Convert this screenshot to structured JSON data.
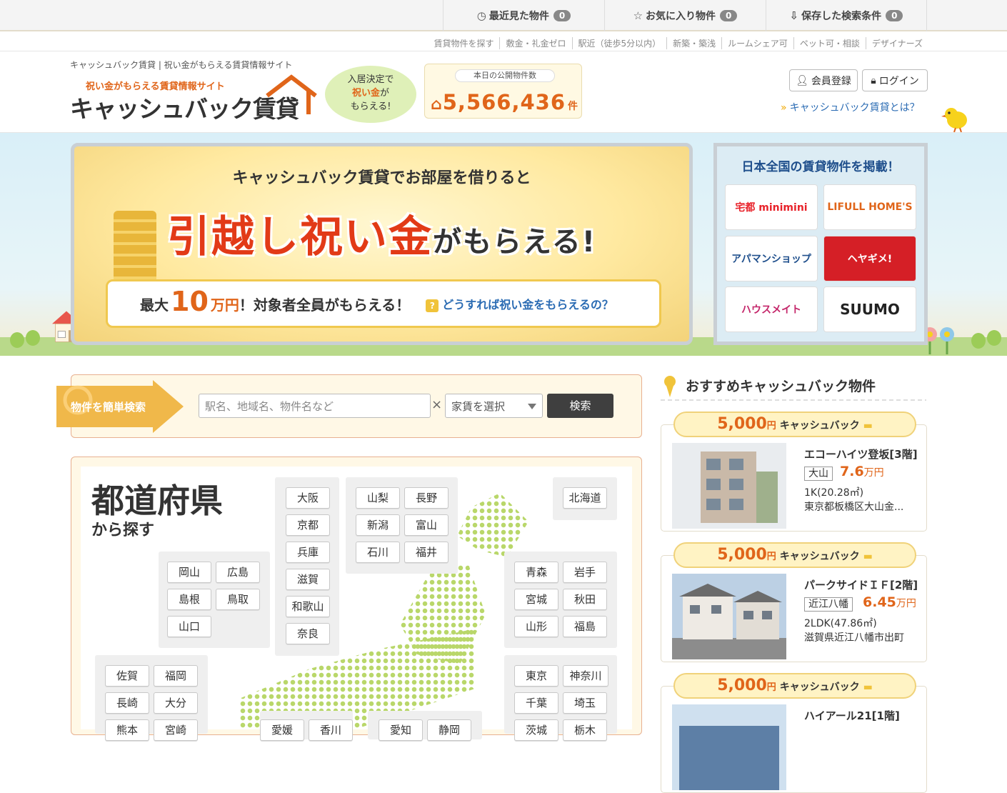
{
  "topbar": {
    "recent": {
      "label": "最近見た物件",
      "count": "0"
    },
    "favorites": {
      "label": "お気に入り物件",
      "count": "0"
    },
    "saved": {
      "label": "保存した検索条件",
      "count": "0"
    }
  },
  "sublinks": [
    "賃貸物件を探す",
    "敷金・礼金ゼロ",
    "駅近（徒歩5分以内）",
    "新築・築浅",
    "ルームシェア可",
    "ペット可・相談",
    "デザイナーズ"
  ],
  "header": {
    "tagline": "キャッシュバック賃貸 | 祝い金がもらえる賃貸情報サイト",
    "logo_sub": "祝い金がもらえる賃貸情報サイト",
    "logo_main": "キャッシュバック賃貸",
    "bubble_l1": "入居決定で",
    "bubble_hl": "祝い金",
    "bubble_l2a": "が",
    "bubble_l3": "もらえる!",
    "count_label": "本日の公開物件数",
    "count_value": "5,566,436",
    "count_unit": "件",
    "register": "会員登録",
    "login": "ログイン",
    "about": "キャッシュバック賃貸とは？"
  },
  "banner": {
    "line1": "キャッシュバック賃貸でお部屋を借りると",
    "line2_main": "引越し祝い金",
    "line2_small": "がもらえる!",
    "pill_pre": "最大",
    "pill_big": "10",
    "pill_unit": "万円",
    "pill_post": "！対象者全員がもらえる！",
    "how": "どうすれば祝い金をもらえるの？"
  },
  "partners": {
    "title": "日本全国の賃貸物件を掲載！",
    "logos": [
      "宅都 minimini",
      "LIFULL HOME'S",
      "アパマンショップ",
      "ヘヤギメ!",
      "ハウスメイト",
      "SUUMO"
    ]
  },
  "search": {
    "label": "物件を簡単検索",
    "placeholder": "駅名、地域名、物件名など",
    "clear": "×",
    "rent_select": "家賃を選択",
    "button": "検索"
  },
  "prefectures": {
    "title": "都道府県",
    "subtitle": "から探す",
    "kinki": [
      "大阪",
      "京都",
      "兵庫",
      "滋賀",
      "和歌山",
      "奈良"
    ],
    "hokuriku": [
      "山梨",
      "長野",
      "新潟",
      "富山",
      "石川",
      "福井"
    ],
    "hokkaido": [
      "北海道"
    ],
    "chugoku": [
      "岡山",
      "広島",
      "島根",
      "鳥取",
      "山口"
    ],
    "tohoku": [
      "青森",
      "岩手",
      "宮城",
      "秋田",
      "山形",
      "福島"
    ],
    "kyushu": [
      "佐賀",
      "福岡",
      "長崎",
      "大分",
      "熊本",
      "宮崎"
    ],
    "kanto": [
      "東京",
      "神奈川",
      "千葉",
      "埼玉",
      "茨城",
      "栃木"
    ],
    "shikoku": [
      "愛媛",
      "香川"
    ],
    "tokai": [
      "愛知",
      "静岡"
    ]
  },
  "recommend": {
    "title": "おすすめキャッシュバック物件",
    "cards": [
      {
        "amount": "5,000",
        "yen": "円",
        "label": "キャッシュバック",
        "name": "エコーハイツ登坂[3階]",
        "station": "大山",
        "price": "7.6",
        "price_unit": "万円",
        "layout": "1K(20.28㎡)",
        "address": "東京都板橋区大山金..."
      },
      {
        "amount": "5,000",
        "yen": "円",
        "label": "キャッシュバック",
        "name": "パークサイドＩＦ[2階]",
        "station": "近江八幡",
        "price": "6.45",
        "price_unit": "万円",
        "layout": "2LDK(47.86㎡)",
        "address": "滋賀県近江八幡市出町"
      },
      {
        "amount": "5,000",
        "yen": "円",
        "label": "キャッシュバック",
        "name": "ハイアール21[1階]",
        "station": "",
        "price": "",
        "price_unit": "",
        "layout": "",
        "address": ""
      }
    ]
  },
  "colors": {
    "accent": "#e0651a",
    "link": "#2a6bb3",
    "button_dark": "#3f3f3f",
    "map_green": "#b9d76a"
  }
}
